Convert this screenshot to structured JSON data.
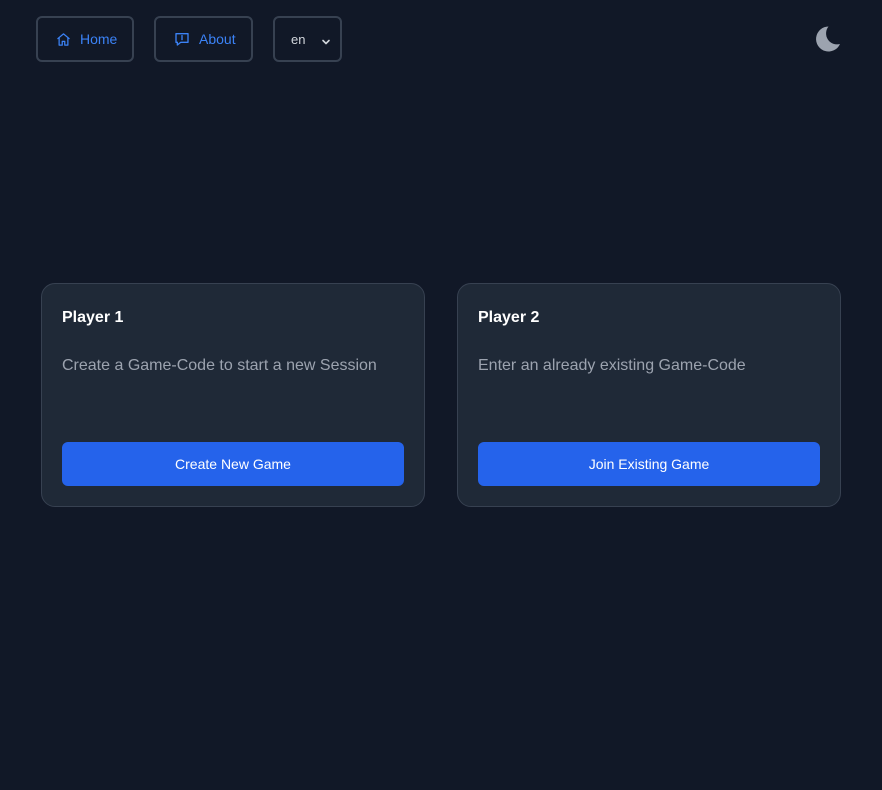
{
  "nav": {
    "home_label": "Home",
    "about_label": "About",
    "language_value": "en",
    "home_icon": "home-icon",
    "about_icon": "chat-info-icon",
    "theme_icon": "moon-icon"
  },
  "players": [
    {
      "title": "Player 1",
      "description": "Create a Game-Code to start a new Session",
      "button_label": "Create New Game"
    },
    {
      "title": "Player 2",
      "description": "Enter an already existing Game-Code",
      "button_label": "Join Existing Game"
    }
  ],
  "colors": {
    "background": "#111827",
    "card": "#1f2937",
    "border": "#374151",
    "accent": "#2563eb",
    "link": "#3b82f6",
    "muted_text": "#9ca3af"
  }
}
